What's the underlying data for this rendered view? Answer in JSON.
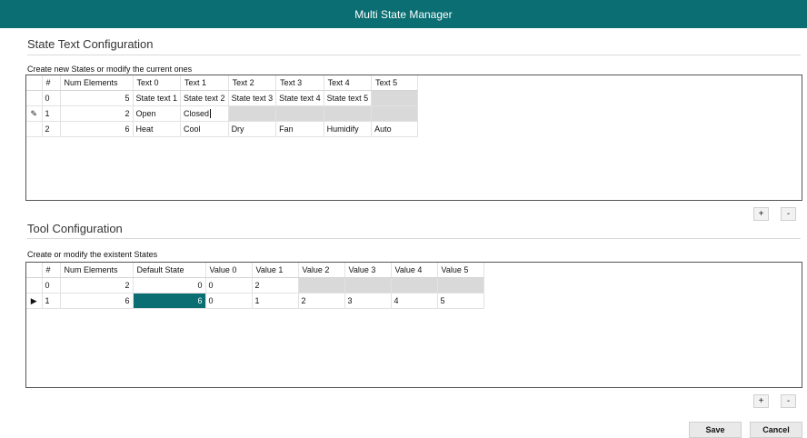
{
  "window": {
    "title": "Multi State Manager"
  },
  "state_text_section": {
    "title": "State Text Configuration",
    "caption": "Create new States or modify the current ones",
    "columns": [
      "#",
      "Num Elements",
      "Text 0",
      "Text 1",
      "Text 2",
      "Text 3",
      "Text 4",
      "Text 5"
    ],
    "rows": [
      {
        "indicator": "",
        "index": "0",
        "num_elements": "5",
        "texts": [
          "State text 1",
          "State text 2",
          "State text 3",
          "State text 4",
          "State text 5",
          ""
        ]
      },
      {
        "indicator": "✎",
        "index": "1",
        "num_elements": "2",
        "texts": [
          "Open",
          "Closed",
          "",
          "",
          "",
          ""
        ]
      },
      {
        "indicator": "",
        "index": "2",
        "num_elements": "6",
        "texts": [
          "Heat",
          "Cool",
          "Dry",
          "Fan",
          "Humidify",
          "Auto"
        ]
      }
    ],
    "add_label": "+",
    "remove_label": "-"
  },
  "tool_section": {
    "title": "Tool Configuration",
    "caption": "Create or modify the existent States",
    "columns": [
      "#",
      "Num Elements",
      "Default State",
      "Value 0",
      "Value 1",
      "Value 2",
      "Value 3",
      "Value 4",
      "Value 5"
    ],
    "rows": [
      {
        "indicator": "",
        "index": "0",
        "num_elements": "2",
        "default_state": "0",
        "values": [
          "0",
          "2",
          "",
          "",
          "",
          ""
        ]
      },
      {
        "indicator": "▶",
        "index": "1",
        "num_elements": "6",
        "default_state": "6",
        "values": [
          "0",
          "1",
          "2",
          "3",
          "4",
          "5"
        ]
      }
    ],
    "add_label": "+",
    "remove_label": "-"
  },
  "footer": {
    "save_label": "Save",
    "cancel_label": "Cancel"
  },
  "colors": {
    "accent": "#0a6e72",
    "empty_cell": "#d9d9d9"
  }
}
